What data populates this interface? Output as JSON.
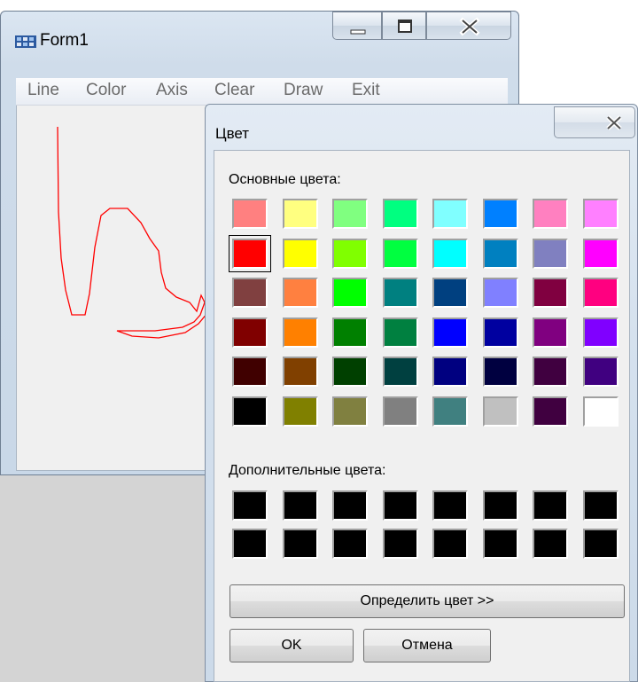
{
  "form1": {
    "title": "Form1",
    "menu": [
      "Line",
      "Color",
      "Axis",
      "Clear",
      "Draw",
      "Exit"
    ],
    "line_color": "#ff0000"
  },
  "dialog": {
    "title": "Цвет",
    "basic_label": "Основные цвета:",
    "custom_label": "Дополнительные цвета:",
    "define_button": "Определить цвет >>",
    "ok_button": "OK",
    "cancel_button": "Отмена",
    "selected_index": 8,
    "basic_colors": [
      "#ff8080",
      "#ffff80",
      "#80ff80",
      "#00ff80",
      "#80ffff",
      "#0080ff",
      "#ff80c0",
      "#ff80ff",
      "#ff0000",
      "#ffff00",
      "#80ff00",
      "#00ff40",
      "#00ffff",
      "#0080c0",
      "#8080c0",
      "#ff00ff",
      "#804040",
      "#ff8040",
      "#00ff00",
      "#008080",
      "#004080",
      "#8080ff",
      "#800040",
      "#ff0080",
      "#800000",
      "#ff8000",
      "#008000",
      "#008040",
      "#0000ff",
      "#0000a0",
      "#800080",
      "#8000ff",
      "#400000",
      "#804000",
      "#004000",
      "#004040",
      "#000080",
      "#000040",
      "#400040",
      "#400080",
      "#000000",
      "#808000",
      "#808040",
      "#808080",
      "#408080",
      "#c0c0c0",
      "#400040",
      "#ffffff"
    ],
    "custom_colors": [
      "#000000",
      "#000000",
      "#000000",
      "#000000",
      "#000000",
      "#000000",
      "#000000",
      "#000000",
      "#000000",
      "#000000",
      "#000000",
      "#000000",
      "#000000",
      "#000000",
      "#000000",
      "#000000"
    ]
  }
}
